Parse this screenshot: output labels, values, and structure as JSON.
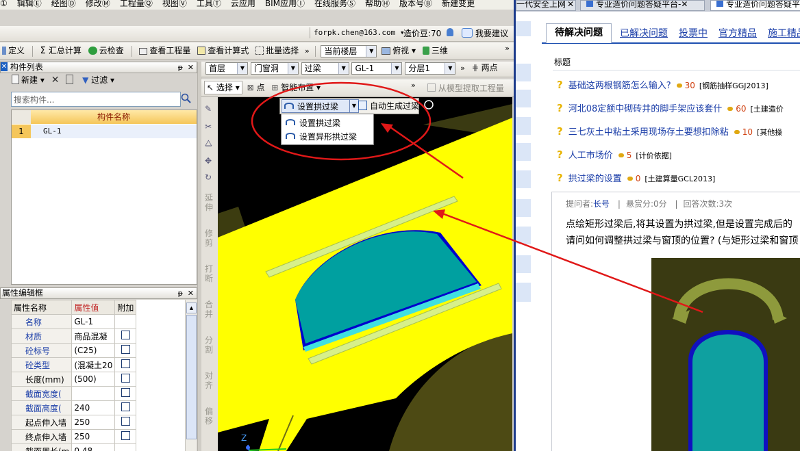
{
  "menubar": [
    "①",
    "辑辑Ⓔ",
    "经图Ⓓ",
    "修改Ⓜ",
    "工程量Ⓠ",
    "视图Ⓥ",
    "工具Ⓣ",
    "云应用",
    "BIM应用Ⓘ",
    "在线服务Ⓢ",
    "帮助Ⓗ",
    "版本号Ⓑ",
    "新建变更"
  ],
  "account": {
    "email": "forpk.chen@163.com",
    "points": "造价豆:70",
    "suggest": "我要建议"
  },
  "toolbar1": {
    "define": "定义",
    "calc": "汇总计算",
    "cloud_check": "云检查",
    "view_qty": "查看工程量",
    "view_formula": "查看计算式",
    "batch_select": "批量选择",
    "floor": "当前楼层",
    "top_view": "俯视",
    "three_d": "三维"
  },
  "toolbar2": {
    "floor": "首层",
    "category": "门窗洞",
    "type": "过梁",
    "item": "GL-1",
    "layer": "分层1",
    "two_point": "两点"
  },
  "toolbar3": {
    "select": "选择",
    "point": "点",
    "smart": "智能布置",
    "extract": "从模型提取工程量"
  },
  "component_list": {
    "title": "构件列表",
    "new": "新建",
    "filter": "过滤",
    "search_placeholder": "搜索构件...",
    "col_name": "构件名称",
    "rows": [
      {
        "num": "1",
        "name": "GL-1"
      }
    ]
  },
  "props": {
    "title": "属性编辑框",
    "headers": {
      "name": "属性名称",
      "value": "属性值",
      "extra": "附加"
    },
    "rows": [
      {
        "name": "名称",
        "value": "GL-1",
        "blue": true,
        "check": false
      },
      {
        "name": "材质",
        "value": "商品混凝",
        "blue": true,
        "check": true
      },
      {
        "name": "砼标号",
        "value": "(C25)",
        "blue": true,
        "check": true
      },
      {
        "name": "砼类型",
        "value": "(混凝土20",
        "blue": true,
        "check": true
      },
      {
        "name": "长度(mm)",
        "value": "(500)",
        "blue": false,
        "check": true
      },
      {
        "name": "截面宽度(",
        "value": "",
        "blue": true,
        "check": true
      },
      {
        "name": "截面高度(",
        "value": "240",
        "blue": true,
        "check": true
      },
      {
        "name": "起点伸入墙",
        "value": "250",
        "blue": false,
        "check": true
      },
      {
        "name": "终点伸入墙",
        "value": "250",
        "blue": false,
        "check": true
      },
      {
        "name": "截面周长(m",
        "value": "0.48",
        "blue": false,
        "check": false
      }
    ]
  },
  "vtools": [
    "延伸",
    "修剪",
    "打断",
    "合并",
    "分割",
    "对齐",
    "偏移"
  ],
  "arch_menu": {
    "main": "设置拱过梁",
    "auto": "自动生成过梁",
    "items": [
      "设置拱过梁",
      "设置异形拱过梁"
    ]
  },
  "axis_label": "Z",
  "browser": {
    "tabs": [
      "一代安全上网",
      "专业造价问题答疑平台-",
      "专业造价问题答疑平"
    ],
    "nav": [
      "待解决问题",
      "已解决问题",
      "投票中",
      "官方精品",
      "施工精品"
    ],
    "list_header": "标题",
    "questions": [
      {
        "title": "基础这两根钢筋怎么输入?",
        "points": "30",
        "tag": "[钢筋抽样GGJ2013]"
      },
      {
        "title": "河北08定额中砌砖井的脚手架应该套什",
        "points": "60",
        "tag": "[土建造价"
      },
      {
        "title": "三七灰土中粘土采用现场存土要想扣除粘",
        "points": "10",
        "tag": "[其他操"
      },
      {
        "title": "人工市场价",
        "points": "5",
        "tag": "[计价依据]"
      },
      {
        "title": "拱过梁的设置",
        "points": "0",
        "tag": "[土建算量GCL2013]"
      }
    ],
    "meta": {
      "asker_label": "提问者:",
      "asker": "长号",
      "reward": "悬赏分:0分",
      "answers": "回答次数:3次"
    },
    "body_lines": [
      "点绘矩形过梁后,将其设置为拱过梁,但是设置完成后的",
      "请问如何调整拱过梁与窗顶的位置? (与矩形过梁和窗顶"
    ]
  },
  "colors": {
    "accent_red": "#e01818",
    "viewport_yellow": "#ffff00",
    "arch_teal": "#009c9c",
    "link_blue": "#1a3da8"
  }
}
